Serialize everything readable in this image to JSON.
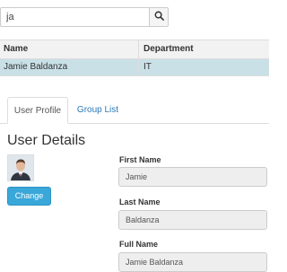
{
  "search": {
    "value": "ja",
    "button_icon": "search-icon"
  },
  "grid": {
    "headers": {
      "name": "Name",
      "department": "Department"
    },
    "rows": [
      {
        "name": "Jamie Baldanza",
        "department": "IT",
        "selected": true
      }
    ],
    "selected_color": "#c9e0e7"
  },
  "tabs": [
    {
      "label": "User Profile",
      "active": true
    },
    {
      "label": "Group List",
      "active": false
    }
  ],
  "details": {
    "title": "User Details",
    "change_label": "Change",
    "fields": {
      "first_name": {
        "label": "First Name",
        "value": "Jamie"
      },
      "last_name": {
        "label": "Last Name",
        "value": "Baldanza"
      },
      "full_name": {
        "label": "Full Name",
        "value": "Jamie Baldanza"
      }
    }
  },
  "colors": {
    "accent": "#3aa7d9",
    "link": "#2a7ab8"
  }
}
